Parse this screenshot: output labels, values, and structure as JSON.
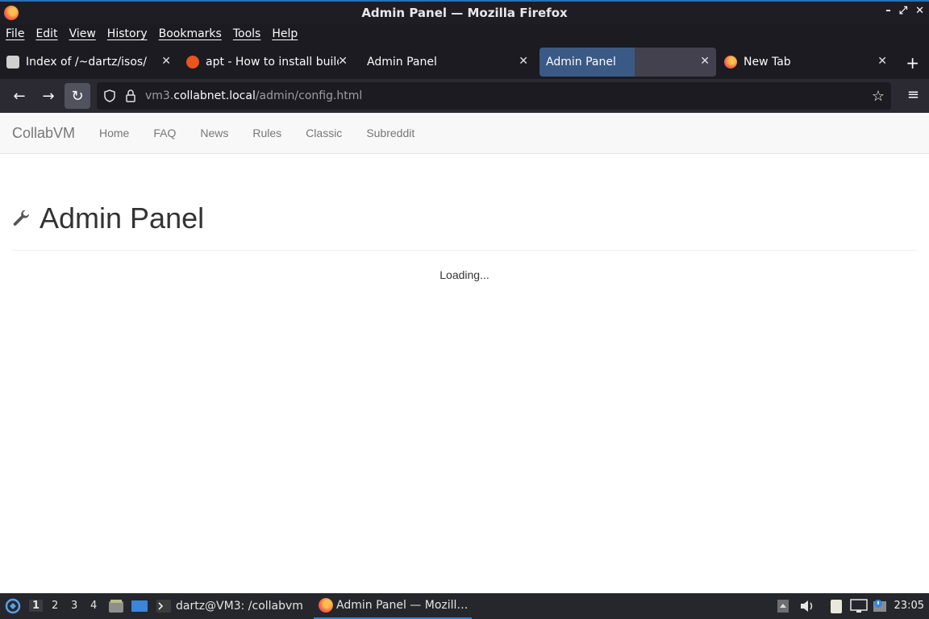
{
  "window": {
    "title": "Admin Panel — Mozilla Firefox"
  },
  "menu": [
    "File",
    "Edit",
    "View",
    "History",
    "Bookmarks",
    "Tools",
    "Help"
  ],
  "tabs": [
    {
      "label": "Index of /~dartz/isos/",
      "icon": "server-icon"
    },
    {
      "label": "apt - How to install build-",
      "icon": "askubuntu-icon"
    },
    {
      "label": "Admin Panel",
      "icon": "none"
    },
    {
      "label": "Admin Panel",
      "icon": "none"
    },
    {
      "label": "New Tab",
      "icon": "firefox-icon"
    }
  ],
  "url": {
    "prefix": "vm3.",
    "host": "collabnet.local",
    "path": "/admin/config.html"
  },
  "site": {
    "brand": "CollabVM",
    "nav": [
      "Home",
      "FAQ",
      "News",
      "Rules",
      "Classic",
      "Subreddit"
    ],
    "heading": "Admin Panel",
    "status": "Loading..."
  },
  "taskbar": {
    "workspaces": [
      "1",
      "2",
      "3",
      "4"
    ],
    "terminal_task": "dartz@VM3: /collabvm",
    "browser_task": "Admin Panel — Mozill…",
    "clock": "23:05"
  },
  "colors": {
    "accent": "#2f80d6",
    "page_bg": "#ffffff",
    "navbar_bg": "#f8f8f8"
  }
}
